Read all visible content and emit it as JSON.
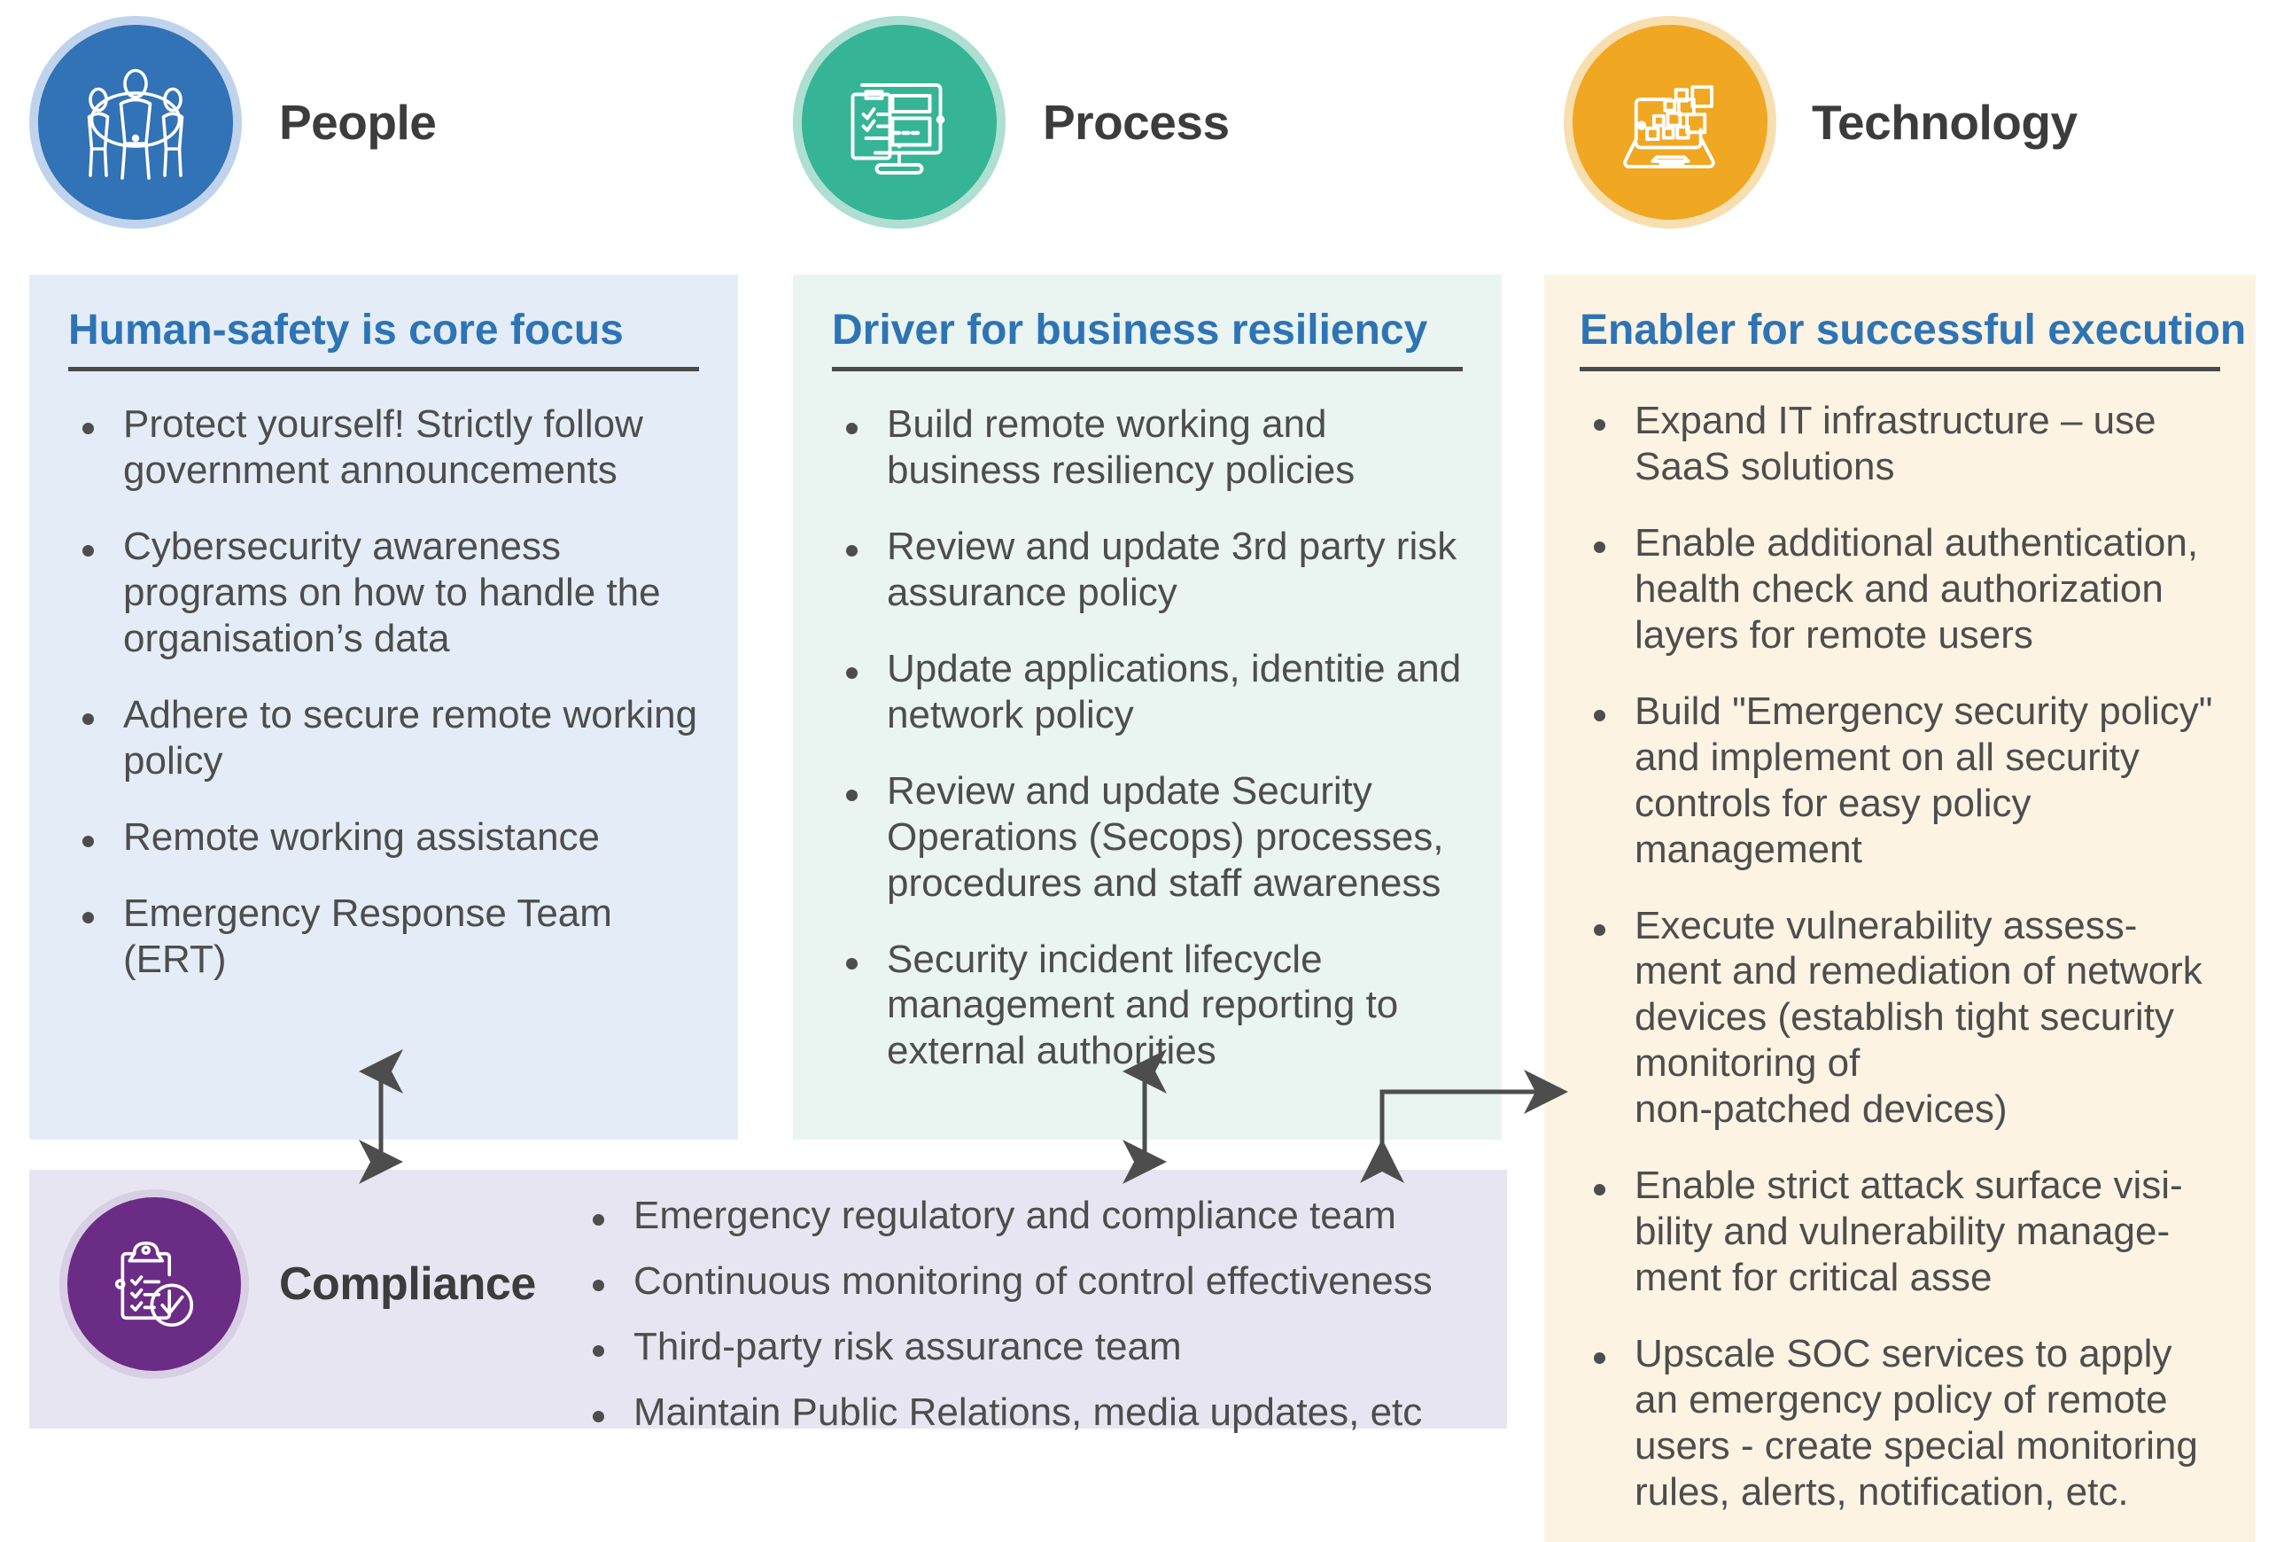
{
  "pillars": [
    {
      "id": "people",
      "header_label": "People",
      "icon": "people-circle-icon",
      "circle_color": "#3272B6",
      "ring_color": "#BFD4EC",
      "panel_color": "#E4EDF7",
      "title": "Human-safety is core focus",
      "title_color": "#2E74B5",
      "bullets": [
        "Protect yourself! Strictly follow government  announcements",
        "Cybersecurity awareness programs on how to handle the organisation’s data",
        "Adhere to secure remote working policy",
        "Remote working assistance",
        "Emergency Response Team (ERT)"
      ]
    },
    {
      "id": "process",
      "header_label": "Process",
      "icon": "checklist-monitor-icon",
      "circle_color": "#35B596",
      "ring_color": "#AEDFD2",
      "panel_color": "#EAF4F0",
      "title": "Driver for business resiliency",
      "title_color": "#2E74B5",
      "bullets": [
        "Build remote working and business resiliency policies",
        "Review and update 3rd party risk assurance policy",
        "Update applications, identitie and network policy",
        "Review and update Security Operations (Secops) processes, procedures and staff awareness",
        "Security incident lifecycle management and reporting to external authorities"
      ]
    },
    {
      "id": "technology",
      "header_label": "Technology",
      "icon": "laptop-network-icon",
      "circle_color": "#F0A722",
      "ring_color": "#F8DFB0",
      "panel_color": "#FDF3E3",
      "title": "Enabler for successful execution",
      "title_color": "#2E74B5",
      "bullets": [
        "Expand IT infrastructure – use SaaS solutions",
        "Enable additional authentication, health check and authorization layers for remote users",
        "Build \"Emergency security policy\" and implement on all security controls for easy policy management",
        "Execute vulnerability assess-ment and remediation of network devices (establish tight security monitoring of\nnon-patched devices)",
        "Enable strict attack surface visi-bility and vulnerability manage-ment for critical asse",
        "Upscale SOC services to apply an emergency policy of remote users - create special monitoring rules, alerts, notification, etc."
      ]
    }
  ],
  "compliance": {
    "label": "Compliance",
    "icon": "clipboard-check-icon",
    "circle_color": "#6B2C85",
    "ring_color": "#D8CFE4",
    "panel_color": "#E8E5F2",
    "bullets": [
      "Emergency regulatory and compliance team",
      "Continuous monitoring of control effectiveness",
      "Third-party risk assurance team",
      "Maintain Public Relations, media updates, etc"
    ]
  },
  "connectors": [
    {
      "name": "people-compliance-arrow",
      "type": "double-vertical"
    },
    {
      "name": "process-compliance-arrow",
      "type": "double-vertical"
    },
    {
      "name": "compliance-technology-arrow",
      "type": "elbow-right"
    }
  ],
  "arrow_color": "#4D4D4D"
}
